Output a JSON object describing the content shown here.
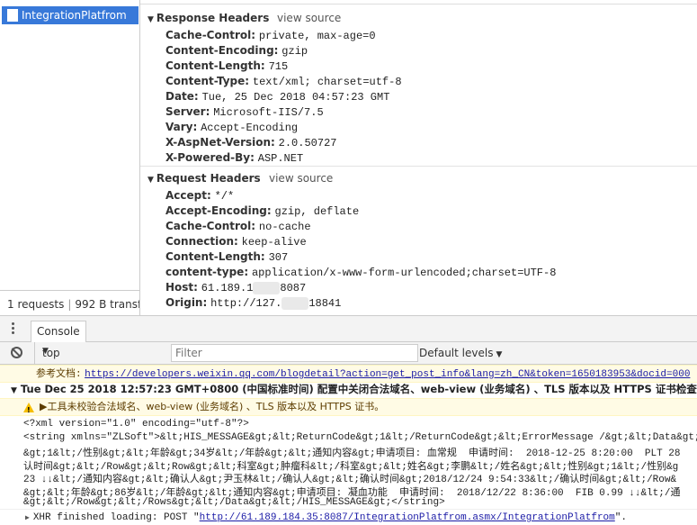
{
  "network": {
    "request_name": "IntegrationPlatfrom",
    "status": {
      "requests": "1 requests",
      "transferred": "992 B transf..."
    },
    "response_headers": {
      "title": "Response Headers",
      "view_source": "view source",
      "rows": [
        {
          "k": "Cache-Control:",
          "v": "private, max-age=0"
        },
        {
          "k": "Content-Encoding:",
          "v": "gzip"
        },
        {
          "k": "Content-Length:",
          "v": "715"
        },
        {
          "k": "Content-Type:",
          "v": "text/xml; charset=utf-8"
        },
        {
          "k": "Date:",
          "v": "Tue, 25 Dec 2018 04:57:23 GMT"
        },
        {
          "k": "Server:",
          "v": "Microsoft-IIS/7.5"
        },
        {
          "k": "Vary:",
          "v": "Accept-Encoding"
        },
        {
          "k": "X-AspNet-Version:",
          "v": "2.0.50727"
        },
        {
          "k": "X-Powered-By:",
          "v": "ASP.NET"
        }
      ]
    },
    "request_headers": {
      "title": "Request Headers",
      "view_source": "view source",
      "rows": [
        {
          "k": "Accept:",
          "v": "*/*"
        },
        {
          "k": "Accept-Encoding:",
          "v": "gzip, deflate"
        },
        {
          "k": "Cache-Control:",
          "v": "no-cache"
        },
        {
          "k": "Connection:",
          "v": "keep-alive"
        },
        {
          "k": "Content-Length:",
          "v": "307"
        },
        {
          "k": "content-type:",
          "v": "application/x-www-form-urlencoded;charset=UTF-8"
        },
        {
          "k": "Host:",
          "v": "61.189.1",
          "v2": "8087"
        },
        {
          "k": "Origin:",
          "v": "http://127.",
          "v2": "18841"
        }
      ]
    }
  },
  "console": {
    "tab": "Console",
    "context": "top",
    "filter_placeholder": "Filter",
    "levels": "Default levels",
    "ref_line_label": "参考文档:",
    "ref_line_url": "https://developers.weixin.qq.com/blogdetail?action=get_post_info&lang=zh_CN&token=1650183953&docid=000",
    "group_header": "Tue Dec 25 2018 12:57:23 GMT+0800 (中国标准时间) 配置中关闭合法域名、web-view (业务域名) 、TLS 版本以及 HTTPS 证书检查",
    "warn_text": "▶工具未校验合法域名、web-view (业务域名) 、TLS 版本以及 HTTPS 证书。",
    "xml_lines": [
      "<?xml version=\"1.0\" encoding=\"utf-8\"?>",
      "<string xmlns=\"ZLSoft\">&lt;HIS_MESSAGE&gt;&lt;ReturnCode&gt;1&lt;/ReturnCode&gt;&lt;ErrorMessage /&gt;&lt;Data&gt;&lt;",
      "&gt;1&lt;/性别&gt;&lt;年龄&gt;34岁&lt;/年龄&gt;&lt;通知内容&gt;申请项目: 血常规  申请时间:  2018-12-25 8:20:00  PLT 28",
      "认时间&gt;&lt;/Row&gt;&lt;Row&gt;&lt;科室&gt;肿瘤科&lt;/科室&gt;&lt;姓名&gt;李鹏&lt;/姓名&gt;&lt;性别&gt;1&lt;/性别&g",
      "23 ↓↓&lt;/通知内容&gt;&lt;确认人&gt;尹玉林&lt;/确认人&gt;&lt;确认时间&gt;2018/12/24 9:54:33&lt;/确认时间&gt;&lt;/Row&",
      "&gt;&lt;年龄&gt;86岁&lt;/年龄&gt;&lt;通知内容&gt;申请项目: 凝血功能  申请时间:  2018/12/22 8:36:00  FIB 0.99 ↓↓&lt;/通",
      "&gt;&lt;/Row&gt;&lt;/Rows&gt;&lt;/Data&gt;&lt;/HIS_MESSAGE&gt;</string>"
    ],
    "xhr_prefix": "XHR finished loading: POST \"",
    "xhr_url": "http://61.189.184.35:8087/IntegrationPlatfrom.asmx/IntegrationPlatfrom",
    "xhr_suffix": "\"."
  },
  "colors": {
    "selected": "#3879d9",
    "warning_bg": "#fffbe5",
    "warning_icon": "#f5bd00",
    "link": "#1a1aa6"
  }
}
